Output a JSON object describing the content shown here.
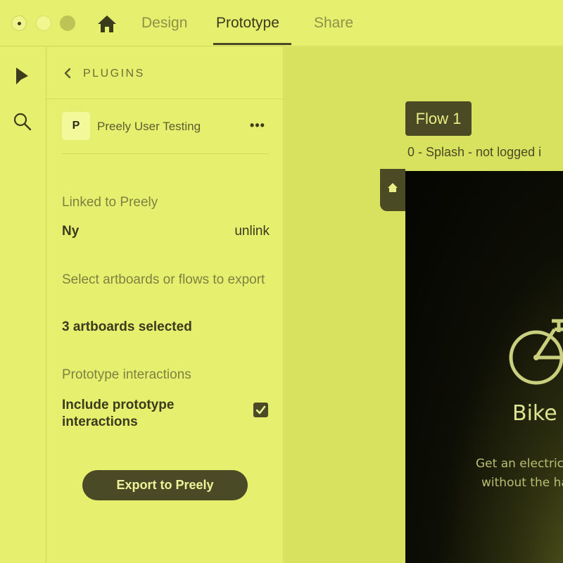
{
  "window": {
    "controls": [
      "close",
      "minimize",
      "zoom"
    ]
  },
  "tabs": {
    "home_icon": "home-icon",
    "design": "Design",
    "prototype": "Prototype",
    "share": "Share",
    "active": "Prototype"
  },
  "tools": [
    {
      "name": "select-tool",
      "icon": "arrow-pointer-icon"
    },
    {
      "name": "search-tool",
      "icon": "search-icon"
    }
  ],
  "panel": {
    "back_icon": "chevron-left-icon",
    "title": "PLUGINS",
    "plugin": {
      "logo_letter": "P",
      "name": "Preely User Testing",
      "more_icon": "more-horizontal-icon",
      "more_label": "•••"
    },
    "linked_label": "Linked to Preely",
    "project_name": "Ny",
    "unlink_label": "unlink",
    "select_label": "Select artboards or flows to export",
    "selection_value": "3 artboards selected",
    "interactions_label": "Prototype interactions",
    "include_interactions_label": "Include prototype interactions",
    "include_interactions_checked": true,
    "export_button": "Export to Preely"
  },
  "canvas": {
    "flow_label": "Flow 1",
    "artboard_name": "0 - Splash - not logged i",
    "home_marker_icon": "home-icon",
    "artboard": {
      "icon": "bicycle-icon",
      "title": "Bike a",
      "subtitle_line1": "Get an electric",
      "subtitle_line2": "without the ha"
    }
  },
  "colors": {
    "accent": "#4a4a26",
    "background": "#e3ec6a",
    "canvas": "#d9e25f"
  }
}
